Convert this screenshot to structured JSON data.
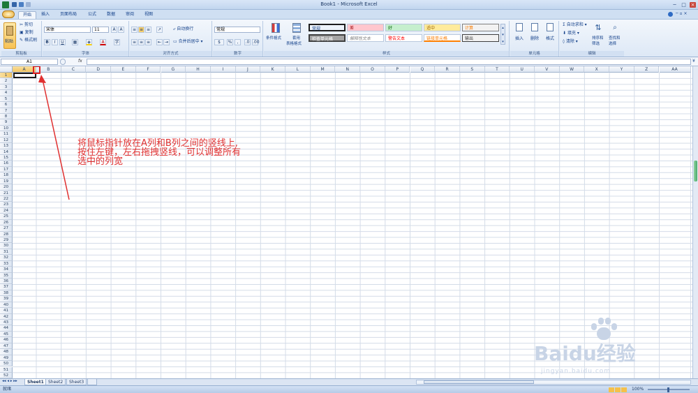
{
  "window": {
    "title": "Book1 - Microsoft Excel"
  },
  "tabs": [
    {
      "label": "开始",
      "active": true
    },
    {
      "label": "插入"
    },
    {
      "label": "页面布局"
    },
    {
      "label": "公式"
    },
    {
      "label": "数据"
    },
    {
      "label": "审阅"
    },
    {
      "label": "视图"
    }
  ],
  "ribbon": {
    "clipboard": {
      "label": "剪贴板",
      "paste": "粘贴",
      "cut": "剪切",
      "copy": "复制",
      "format_painter": "格式刷"
    },
    "font": {
      "label": "字体",
      "name": "宋体",
      "size": "11"
    },
    "alignment": {
      "label": "对齐方式",
      "wrap": "自动换行",
      "merge": "合并后居中"
    },
    "number": {
      "label": "数字",
      "format": "常规"
    },
    "styles": {
      "label": "样式",
      "conditional": "条件格式",
      "as_table_1": "套用",
      "as_table_2": "表格格式",
      "cells": [
        {
          "text": "常规",
          "bg": "#ffffff",
          "fg": "#000000"
        },
        {
          "text": "差",
          "bg": "#ffc7ce",
          "fg": "#9c0006"
        },
        {
          "text": "好",
          "bg": "#c6efce",
          "fg": "#006100"
        },
        {
          "text": "适中",
          "bg": "#ffeb9c",
          "fg": "#9c6500"
        },
        {
          "text": "计算",
          "bg": "#f2f2f2",
          "fg": "#fa7d00"
        },
        {
          "text": "检查单元格",
          "bg": "#a5a5a5",
          "fg": "#ffffff"
        },
        {
          "text": "解释性文本",
          "bg": "#ffffff",
          "fg": "#7f7f7f"
        },
        {
          "text": "警告文本",
          "bg": "#ffffff",
          "fg": "#ff0000"
        },
        {
          "text": "链接单元格",
          "bg": "#ffffff",
          "fg": "#fa7d00"
        },
        {
          "text": "输出",
          "bg": "#f2f2f2",
          "fg": "#3f3f3f"
        }
      ]
    },
    "cells_group": {
      "label": "单元格",
      "insert": "插入",
      "delete": "删除",
      "format": "格式"
    },
    "editing": {
      "label": "编辑",
      "autosum": "自动求和",
      "fill": "填充",
      "clear": "清除",
      "sort_1": "排序和",
      "sort_2": "筛选",
      "find_1": "查找和",
      "find_2": "选择"
    }
  },
  "formula_bar": {
    "name_box": "A1",
    "fx": "fx",
    "value": ""
  },
  "columns": [
    "A",
    "B",
    "C",
    "D",
    "E",
    "F",
    "G",
    "H",
    "I",
    "J",
    "K",
    "L",
    "M",
    "N",
    "O",
    "P",
    "Q",
    "R",
    "S",
    "T",
    "U",
    "V",
    "W",
    "X",
    "Y",
    "Z",
    "AA"
  ],
  "row_count": 52,
  "annotation": {
    "line1": "将鼠标指针放在A列和B列之间的竖线上,",
    "line2": "按住左键，左右拖拽竖线，可以调整所有",
    "line3": "选中的列宽",
    "color": "#e03030"
  },
  "sheets": [
    {
      "name": "Sheet1",
      "active": true
    },
    {
      "name": "Sheet2"
    },
    {
      "name": "Sheet3"
    }
  ],
  "status": {
    "ready": "就绪",
    "zoom": "100%"
  },
  "watermark": {
    "text": "Baidu经验",
    "url": "jingyan.baidu.com"
  }
}
